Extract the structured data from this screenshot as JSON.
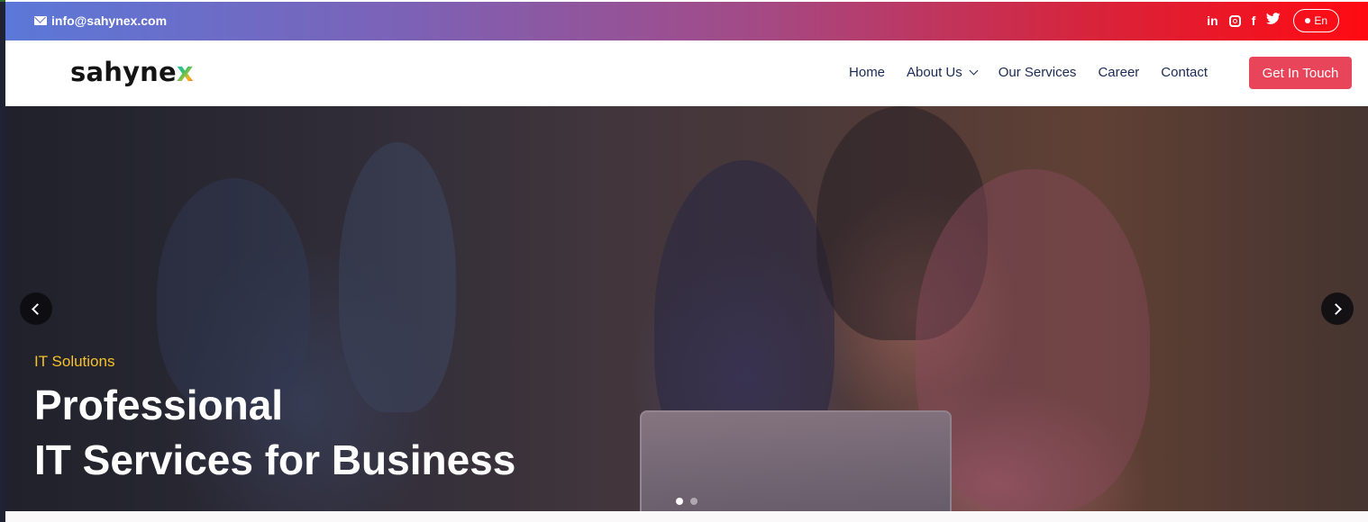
{
  "topbar": {
    "email": "info@sahynex.com",
    "socials": [
      "linkedin-icon",
      "instagram-icon",
      "facebook-icon",
      "twitter-icon"
    ],
    "language": "En",
    "colors": {
      "gradient_start": "#5b78d8",
      "gradient_end": "#ff0a12"
    }
  },
  "nav": {
    "logo_main": "sahyne",
    "logo_accent": "x",
    "items": [
      {
        "label": "Home"
      },
      {
        "label": "About Us"
      },
      {
        "label": "Our Services"
      },
      {
        "label": "Career"
      },
      {
        "label": "Contact"
      }
    ],
    "cta": "Get In Touch",
    "cta_color": "#e9455a"
  },
  "hero": {
    "eyebrow": "IT Solutions",
    "headline_line1": "Professional",
    "headline_line2": "IT Services for Business",
    "slide_count": 2,
    "active_slide": 1,
    "eyebrow_color": "#f6c12a"
  }
}
